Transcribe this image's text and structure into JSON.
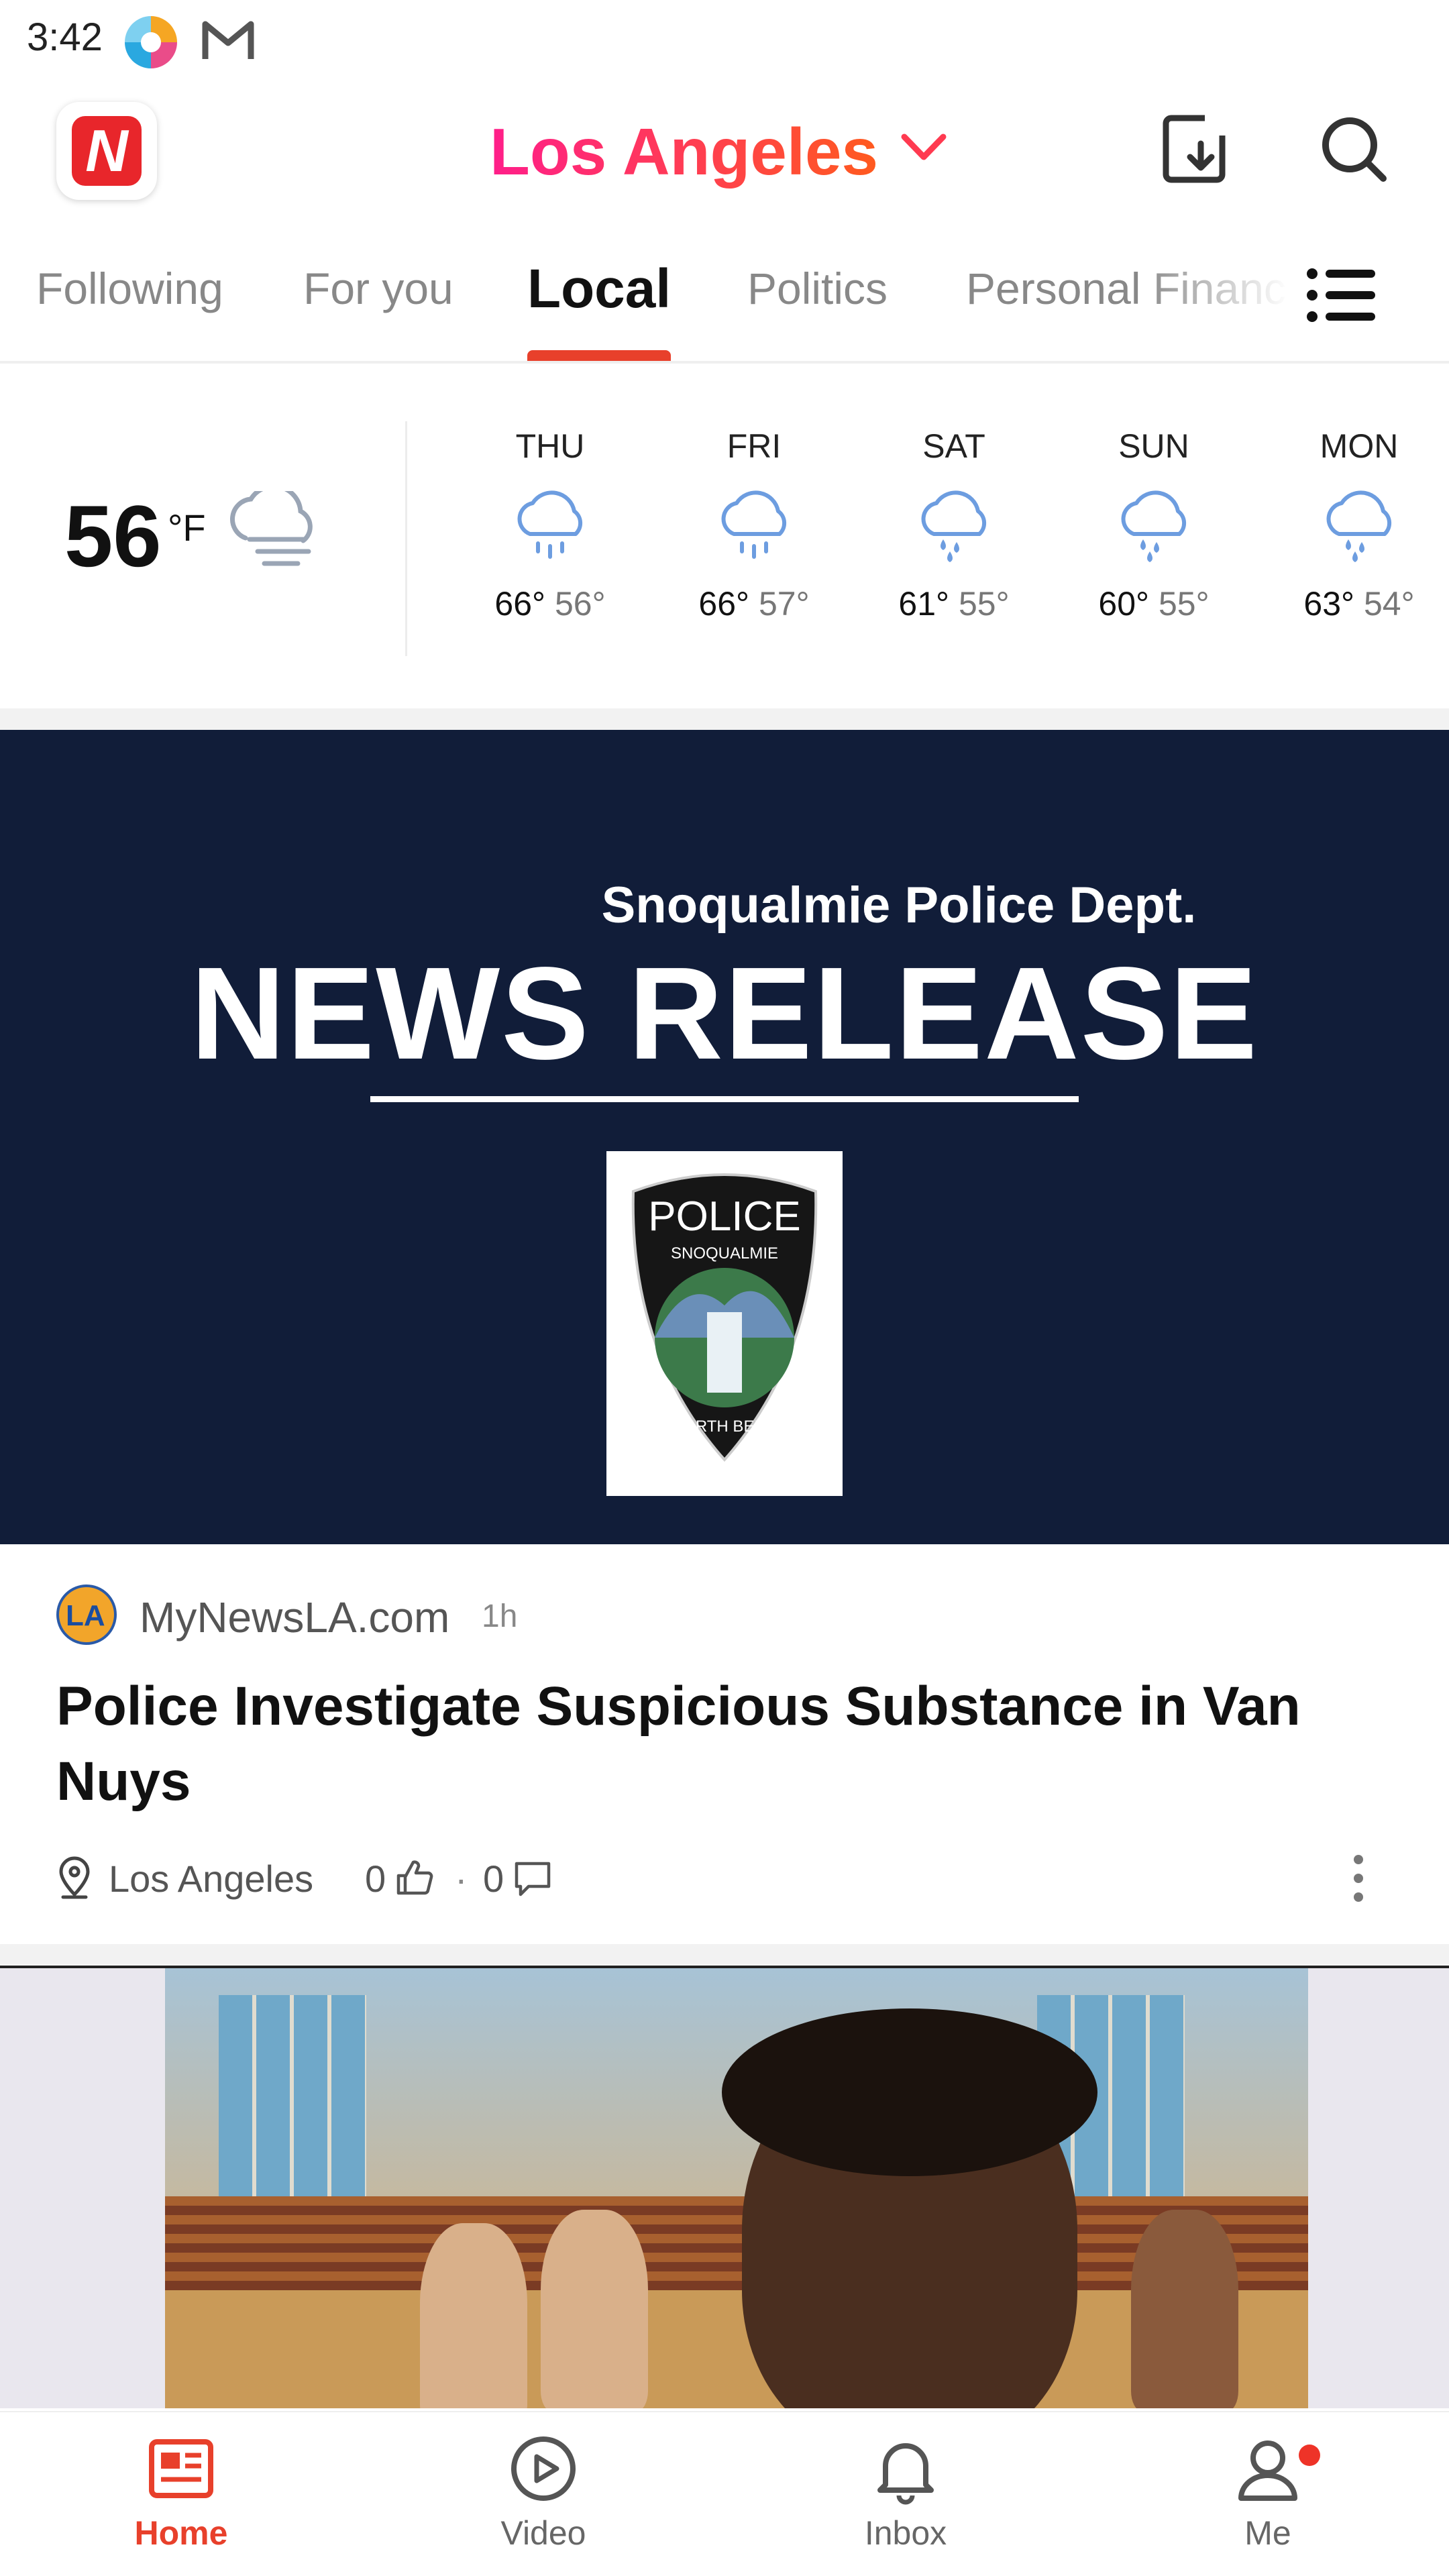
{
  "status_bar": {
    "time": "3:42"
  },
  "header": {
    "location": "Los Angeles"
  },
  "tabs": [
    {
      "label": "Following"
    },
    {
      "label": "For you"
    },
    {
      "label": "Local"
    },
    {
      "label": "Politics"
    },
    {
      "label": "Personal Financ"
    }
  ],
  "weather": {
    "current_temp": "56",
    "unit": "°F",
    "current_icon": "cloud-fog-icon",
    "days": [
      {
        "name": "THU",
        "high": "66°",
        "low": "56°",
        "icon": "rain-icon"
      },
      {
        "name": "FRI",
        "high": "66°",
        "low": "57°",
        "icon": "rain-icon"
      },
      {
        "name": "SAT",
        "high": "61°",
        "low": "55°",
        "icon": "heavy-rain-icon"
      },
      {
        "name": "SUN",
        "high": "60°",
        "low": "55°",
        "icon": "heavy-rain-icon"
      },
      {
        "name": "MON",
        "high": "63°",
        "low": "54°",
        "icon": "heavy-rain-icon"
      }
    ]
  },
  "article1": {
    "image": {
      "subtitle": "Snoqualmie Police Dept.",
      "title": "NEWS RELEASE",
      "badge_top": "POLICE",
      "badge_arc": "SNOQUALMIE",
      "badge_bottom": "NORTH BEND"
    },
    "source_logo": "LA",
    "source": "MyNewsLA.com",
    "time": "1h",
    "headline": "Police Investigate Suspicious Substance in Van Nuys",
    "location": "Los Angeles",
    "likes": "0",
    "separator": "·",
    "comments": "0"
  },
  "nav": [
    {
      "label": "Home",
      "icon": "news-icon",
      "active": true
    },
    {
      "label": "Video",
      "icon": "play-circle-icon",
      "active": false
    },
    {
      "label": "Inbox",
      "icon": "bell-icon",
      "active": false
    },
    {
      "label": "Me",
      "icon": "user-icon",
      "active": false
    }
  ],
  "colors": {
    "accent": "#e8402b",
    "location_gradient": [
      "#ff1e8a",
      "#ff5a1e"
    ],
    "hero_bg": "#111d39"
  }
}
